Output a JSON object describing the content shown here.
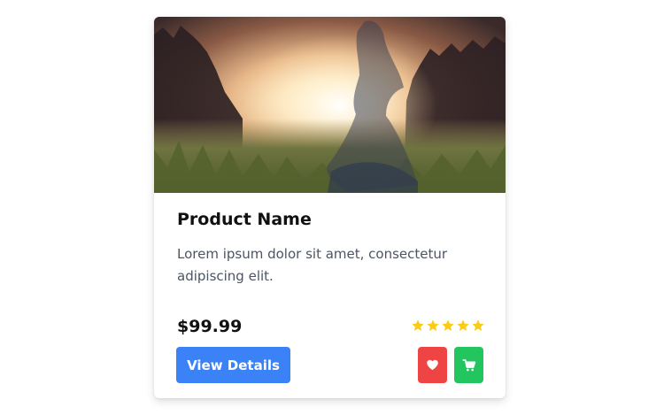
{
  "product": {
    "name": "Product Name",
    "description": "Lorem ipsum dolor sit amet, consectetur adipiscing elit.",
    "price": "$99.99",
    "rating": 5,
    "rating_max": 5,
    "image_icon": "sunset-meadow-photo"
  },
  "actions": {
    "view_details_label": "View Details",
    "wishlist_icon": "heart-icon",
    "cart_icon": "shopping-cart-icon"
  },
  "colors": {
    "primary": "#3b82f6",
    "wishlist": "#ef4444",
    "cart": "#22c55e",
    "star": "#facc15"
  }
}
